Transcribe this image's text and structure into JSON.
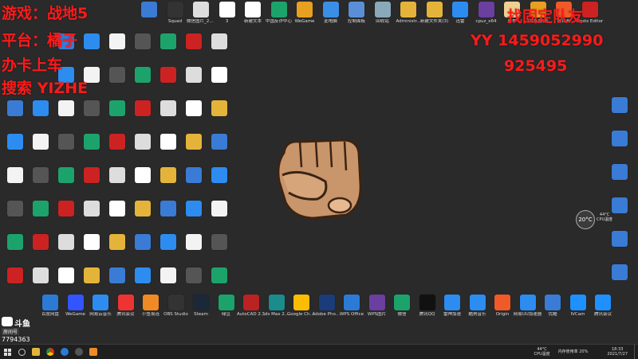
{
  "overlay": {
    "line1": "游戏：战地5",
    "line2": "平台：橘子",
    "line3": "办卡上车",
    "line4": "搜索 YIZHE",
    "right1": "找固定队友",
    "right2": "YY 1459052990",
    "right3": "925495"
  },
  "desktop_icons": [
    {
      "label": "",
      "icon": "app-icon",
      "color": "#3a7bd5"
    },
    {
      "label": "Squad",
      "icon": "squad-icon",
      "color": "#333"
    },
    {
      "label": "微信图片_2021071...",
      "icon": "image-icon",
      "color": "#ddd"
    },
    {
      "label": "3",
      "icon": "doc-icon",
      "color": "#fff"
    },
    {
      "label": "新建文本",
      "icon": "doc-icon",
      "color": "#fff"
    },
    {
      "label": "中国反诈中心",
      "icon": "shield-icon",
      "color": "#1ca36b"
    },
    {
      "label": "WeGame",
      "icon": "wegame-icon",
      "color": "#e8a020"
    },
    {
      "label": "此电脑",
      "icon": "computer-icon",
      "color": "#3a8ee6"
    },
    {
      "label": "控制面板",
      "icon": "control-panel-icon",
      "color": "#5a8fd8"
    },
    {
      "label": "回收站",
      "icon": "recycle-bin-icon",
      "color": "#8ab"
    },
    {
      "label": "Administr...",
      "icon": "user-folder-icon",
      "color": "#e4b43a"
    },
    {
      "label": "新建文件夹(3)",
      "icon": "folder-icon",
      "color": "#e4b43a"
    },
    {
      "label": "迅雷",
      "icon": "thunder-icon",
      "color": "#2d8cf0"
    },
    {
      "label": "cpuz_x64",
      "icon": "cpu-icon",
      "color": "#6a3fa0"
    },
    {
      "label": "原神",
      "icon": "game-icon",
      "color": "#f0d090"
    },
    {
      "label": "(论坛版) 5",
      "icon": "v-icon",
      "color": "#e8a020"
    },
    {
      "label": "向日葵",
      "icon": "sunflower-icon",
      "color": "#f05a28"
    },
    {
      "label": "Hosts Editor",
      "icon": "hosts-icon",
      "color": "#c22"
    }
  ],
  "taskbar": {
    "apps": [
      "Start",
      "Search",
      "Explorer",
      "Chrome",
      "Edge",
      "OBS",
      "App"
    ],
    "temp": "44°C",
    "cpu_label": "CPU温度",
    "mem": "内存使用率 20%",
    "time": "18:33",
    "date": "2021/7/27"
  },
  "widget": {
    "temp": "20°C",
    "cpu": "44°C",
    "cpu_label": "CPU温度"
  },
  "stream": {
    "brand": "斗鱼",
    "id_label": "房间号",
    "room": "7794363"
  },
  "dock_icons": [
    "百度网盘",
    "WeGame",
    "网易云音乐",
    "腾讯会议",
    "小鱼易连",
    "OBS Studio",
    "Steam",
    "绿豆",
    "AutoCAD 2016",
    "3ds Max 2016",
    "Google Chrome",
    "Adobe Photoshop",
    "WPS Office",
    "WPS图片",
    "微信",
    "腾讯QQ",
    "雷神加速",
    "酷狗音乐",
    "Origin",
    "网易UU加速器",
    "优酷",
    "IVCam",
    "腾讯会议"
  ]
}
